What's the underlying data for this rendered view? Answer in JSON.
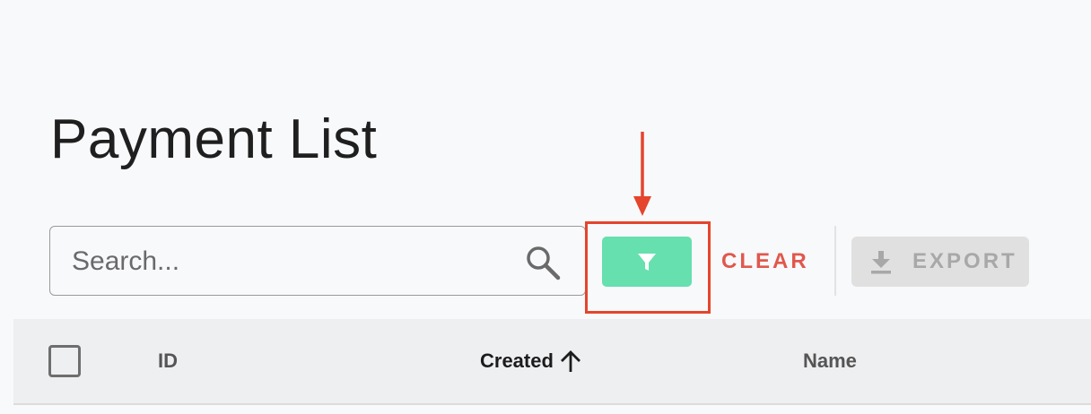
{
  "page": {
    "title": "Payment List"
  },
  "search": {
    "placeholder": "Search..."
  },
  "toolbar": {
    "clear_label": "CLEAR",
    "export_label": "EXPORT"
  },
  "table": {
    "columns": [
      {
        "label": "ID"
      },
      {
        "label": "Created",
        "sort": "ascending"
      },
      {
        "label": "Name"
      }
    ]
  },
  "icons": {
    "search": "search-icon",
    "filter": "filter-icon",
    "download": "download-icon",
    "sort": "arrow-up-icon"
  },
  "colors": {
    "accent": "#66e0ae",
    "danger": "#e0584d",
    "annotation": "#e4452c",
    "disabled": "#e0e0e0"
  }
}
